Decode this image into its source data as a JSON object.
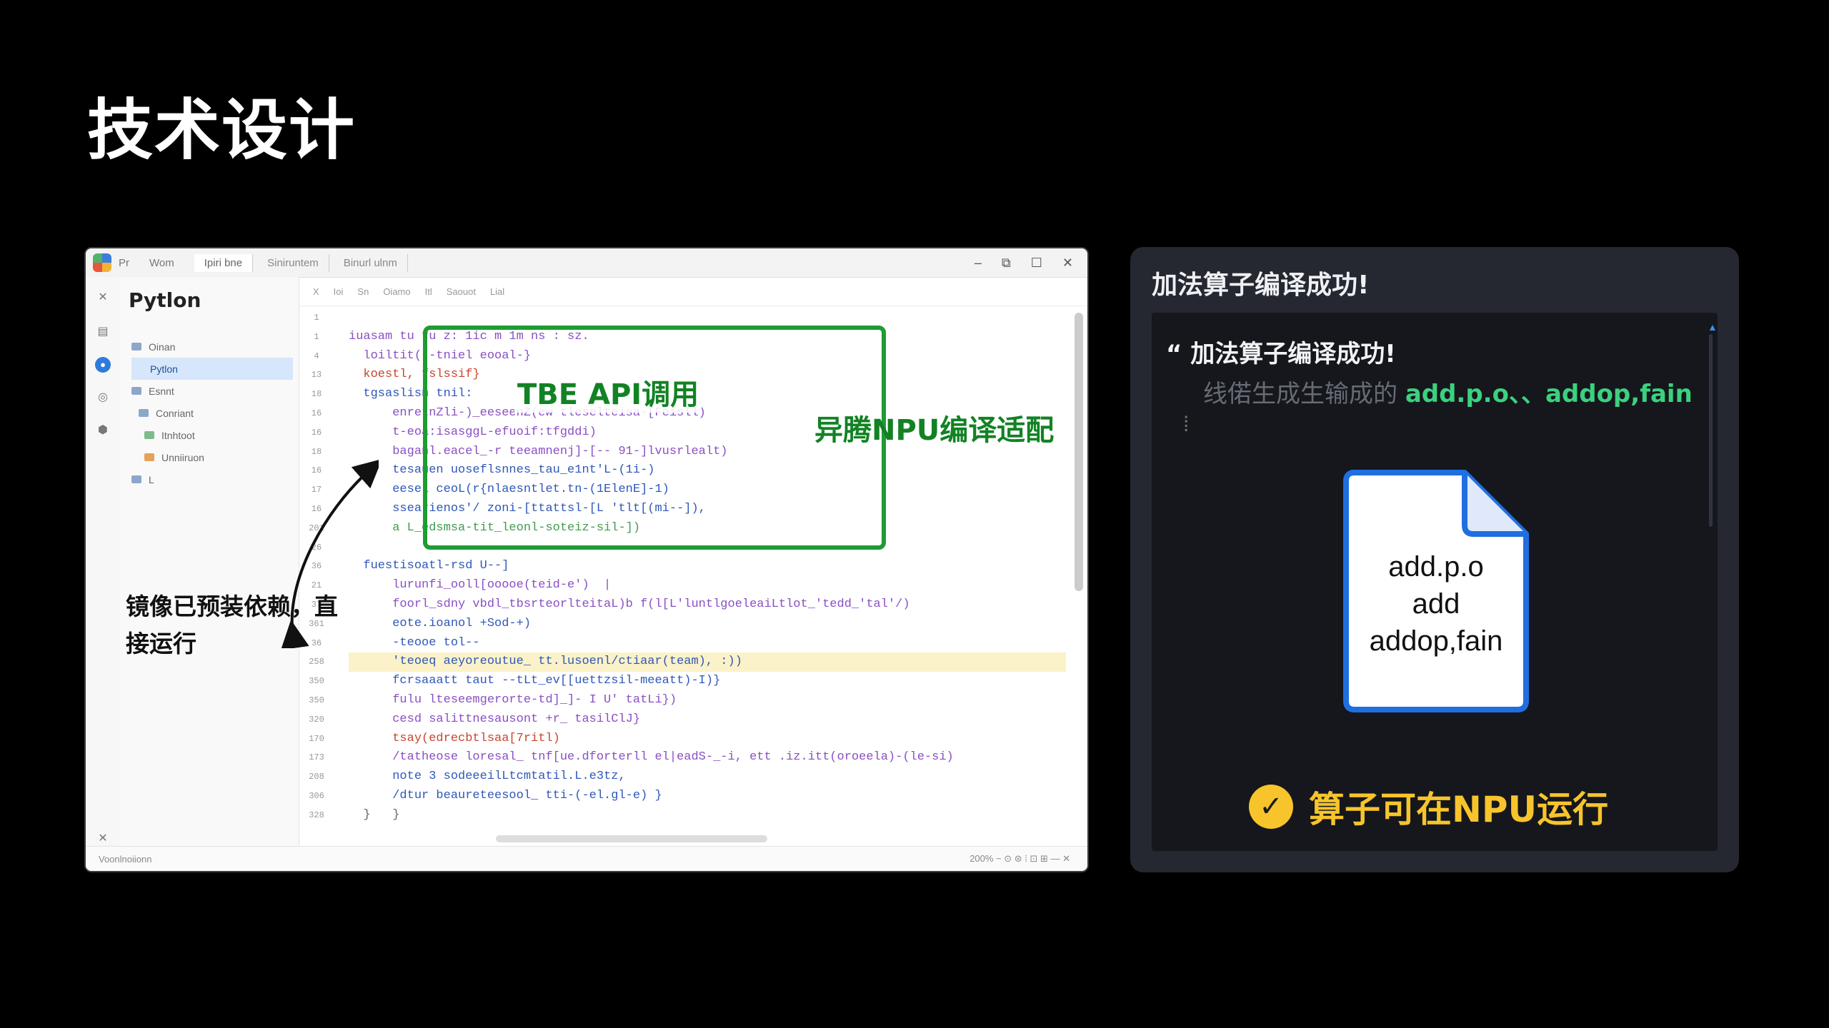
{
  "slide": {
    "title": "技术设计"
  },
  "ide": {
    "titlebar": {
      "menu": [
        "Pr",
        "Wom"
      ],
      "tabs": [
        "Ipiri bne",
        "Siniruntem",
        "Binurl ulnm"
      ],
      "controls": [
        "–",
        "⧉",
        "☐",
        "✕"
      ]
    },
    "explorer": {
      "title": "Pytlon",
      "items": [
        "Oinan",
        "Pytlon",
        "Esnnt",
        "Conriant",
        "Itnhtoot",
        "Unniiruon",
        "L"
      ]
    },
    "editor": {
      "toolbar": [
        "X",
        "Ioi",
        "Sn",
        "Oiamo",
        "Itl",
        "Saouot",
        "Lial"
      ],
      "line_numbers": [
        "1",
        "1",
        "4",
        "13",
        "18",
        "16",
        "16",
        "18",
        "16",
        "17",
        "16",
        "201",
        "26",
        "36",
        "21",
        "37",
        "361",
        "36",
        "258",
        "350",
        "350",
        "320",
        "170",
        "173",
        "208",
        "306",
        "328"
      ],
      "code_lines": [
        {
          "text": "",
          "cls": ""
        },
        {
          "text": "iuasam tu fu z: 1ic m 1m ns : sz.",
          "cls": "c-purple"
        },
        {
          "text": "  loiltit( -tniel eooal-}",
          "cls": "c-purple"
        },
        {
          "text": "  koestl, fslssif}",
          "cls": "c-red"
        },
        {
          "text": "  tgsaslisn tnil:",
          "cls": "c-blue"
        },
        {
          "text": "      enretnZli-)_eeseenZ(ew tleselteisa-[Feisll)",
          "cls": "c-purple"
        },
        {
          "text": "      t-eoa:isasggL-efuoif:tfgddi)",
          "cls": "c-purple"
        },
        {
          "text": "      baganl.eacel_-r teeamnenj]-[-- 91-]lvusrlealt)",
          "cls": "c-purple"
        },
        {
          "text": "      tesauen uoseflsnnes_tau_e1nt'L-(1i-)",
          "cls": "c-blue"
        },
        {
          "text": "      eesel ceoL(r{nlaesntlet.tn-(1ElenE]-1)",
          "cls": "c-blue"
        },
        {
          "text": "      ssearienos'/ zoni-[ttattsl-[L 'tlt[(mi--]),",
          "cls": "c-blue"
        },
        {
          "text": "      a L_edsmsa-tit_leonl-soteiz-sil-])",
          "cls": "c-green"
        },
        {
          "text": "",
          "cls": ""
        },
        {
          "text": "  fuestisoatl-rsd U--]",
          "cls": "c-blue"
        },
        {
          "text": "      lurunfi_ooll[ooooe(teid-e')  |",
          "cls": "c-purple"
        },
        {
          "text": "      foorl_sdny vbdl_tbsrteorlteitaL)b f(l[L'luntlgoeleaiLtlot_'tedd_'tal'/)",
          "cls": "c-purple"
        },
        {
          "text": "      eote.ioanol +Sod-+)",
          "cls": "c-blue"
        },
        {
          "text": "      -teooe tol--",
          "cls": "c-blue"
        },
        {
          "text": "      'teoeq aeyoreoutue_ tt.lusoenl/ctiaar(team), :))",
          "cls": "c-blue hl"
        },
        {
          "text": "      fcrsaaatt taut --tLt_ev[[uettzsil-meeatt)-I)}",
          "cls": "c-blue"
        },
        {
          "text": "      fulu lteseemgerorte-td]_]- I U' tatLi})",
          "cls": "c-purple"
        },
        {
          "text": "      cesd salittnesausont +r_ tasilClJ}",
          "cls": "c-purple"
        },
        {
          "text": "      tsay(edrecbtlsaa[7ritl)",
          "cls": "c-red"
        },
        {
          "text": "      /tatheose loresal_ tnf[ue.dforterll el|eadS-_-i, ett .iz.itt(oroeela)-(le-si)",
          "cls": "c-purple"
        },
        {
          "text": "      note 3 sodeeeilLtcmtatil.L.e3tz,",
          "cls": "c-blue"
        },
        {
          "text": "      /dtur beaureteesool_ tti-(-el.gl-e) }",
          "cls": "c-blue"
        },
        {
          "text": "  }   }",
          "cls": "c-gray"
        }
      ]
    },
    "annotations": {
      "tbe_label": "TBE API调用",
      "npu_label": "异腾NPU编译适配",
      "preinstalled_note": "镜像已预装依赖，直接运行"
    },
    "statusbar": {
      "left": "Voonlnoiionn",
      "right": "200% ~ ⊙  ⊜  ⁞  ⊡  ⊞  ―  ✕"
    }
  },
  "panel": {
    "header": "加法算子编译成功!",
    "terminal": {
      "line1_prefix": "“",
      "line1": "加法算子编译成功!",
      "line2_prefix": "线偌生成生输成的",
      "line2_files": "add.p.o、、addop,fain",
      "cursor": "⁞"
    },
    "file_icon": {
      "lines": [
        "add.p.o",
        "add",
        "addop,fain"
      ]
    },
    "success_text": "算子可在NPU运行"
  },
  "colors": {
    "green_box": "#1e9c32",
    "terminal_green": "#3bd17f",
    "success_yellow": "#f7c42b",
    "file_blue": "#1f6fe0"
  }
}
